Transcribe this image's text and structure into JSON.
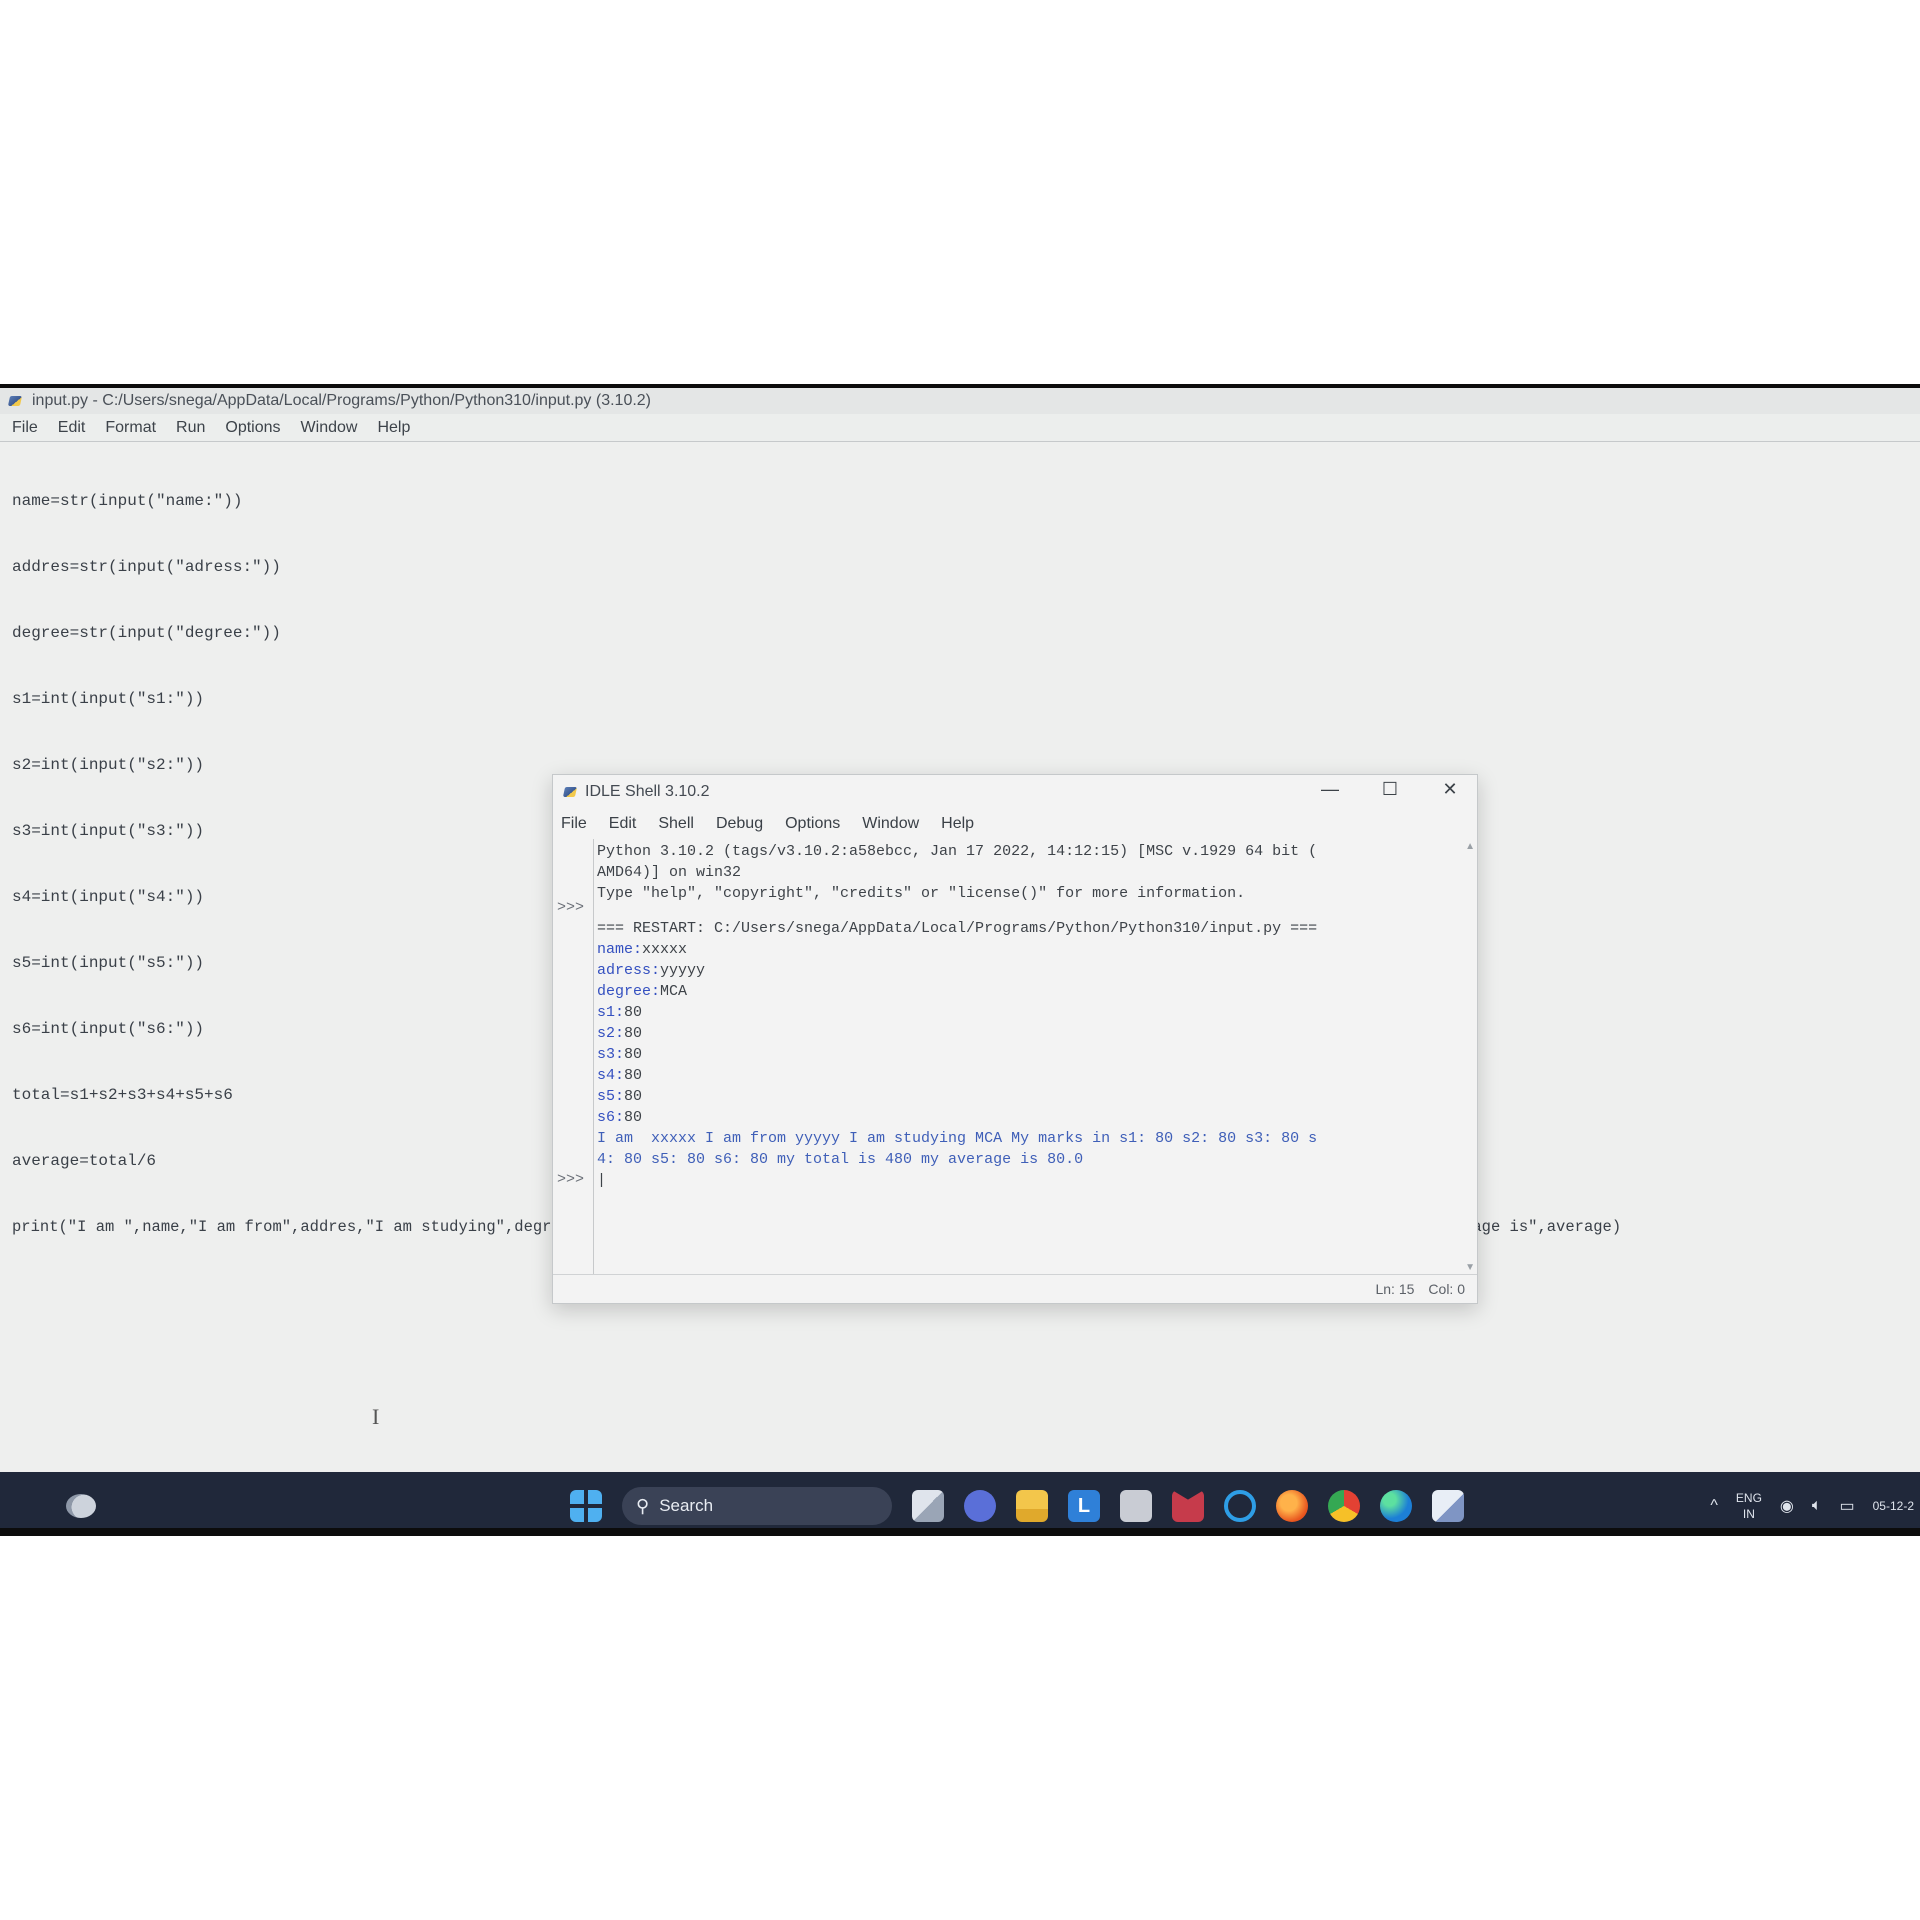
{
  "editor": {
    "title": "input.py - C:/Users/snega/AppData/Local/Programs/Python/Python310/input.py (3.10.2)",
    "menu": [
      "File",
      "Edit",
      "Format",
      "Run",
      "Options",
      "Window",
      "Help"
    ],
    "code_lines": [
      "name=str(input(\"name:\"))",
      "addres=str(input(\"adress:\"))",
      "degree=str(input(\"degree:\"))",
      "s1=int(input(\"s1:\"))",
      "s2=int(input(\"s2:\"))",
      "s3=int(input(\"s3:\"))",
      "s4=int(input(\"s4:\"))",
      "s5=int(input(\"s5:\"))",
      "s6=int(input(\"s6:\"))",
      "total=s1+s2+s3+s4+s5+s6",
      "average=total/6",
      "print(\"I am \",name,\"I am from\",addres,\"I am studying\",degree,\"My marks in\",\"s1:\",s1,\"s2:\",s2,\"s3:\",s3,\"s4:\",s4,\"s5:\",s5,\"s6:\",s6,\"my total is\",total,\"my average is\",average)"
    ]
  },
  "shell": {
    "title": "IDLE Shell 3.10.2",
    "controls": {
      "minimize": "—",
      "maximize": "☐",
      "close": "✕"
    },
    "menu": [
      "File",
      "Edit",
      "Shell",
      "Debug",
      "Options",
      "Window",
      "Help"
    ],
    "prompt": ">>>",
    "banner": [
      "Python 3.10.2 (tags/v3.10.2:a58ebcc, Jan 17 2022, 14:12:15) [MSC v.1929 64 bit (",
      "AMD64)] on win32",
      "Type \"help\", \"copyright\", \"credits\" or \"license()\" for more information."
    ],
    "restart": "=== RESTART: C:/Users/snega/AppData/Local/Programs/Python/Python310/input.py ===",
    "inputs": [
      {
        "prompt": "name:",
        "value": "xxxxx"
      },
      {
        "prompt": "adress:",
        "value": "yyyyy"
      },
      {
        "prompt": "degree:",
        "value": "MCA"
      },
      {
        "prompt": "s1:",
        "value": "80"
      },
      {
        "prompt": "s2:",
        "value": "80"
      },
      {
        "prompt": "s3:",
        "value": "80"
      },
      {
        "prompt": "s4:",
        "value": "80"
      },
      {
        "prompt": "s5:",
        "value": "80"
      },
      {
        "prompt": "s6:",
        "value": "80"
      }
    ],
    "output": [
      "I am  xxxxx I am from yyyyy I am studying MCA My marks in s1: 80 s2: 80 s3: 80 s",
      "4: 80 s5: 80 s6: 80 my total is 480 my average is 80.0"
    ],
    "status": {
      "line": "Ln: 15",
      "col": "Col: 0"
    }
  },
  "taskbar": {
    "search_label": "Search",
    "icons": [
      "start-icon",
      "search-icon",
      "task-view-icon",
      "chat-icon",
      "file-explorer-icon",
      "l-app-icon",
      "store-icon",
      "mcafee-icon",
      "cortana-icon",
      "firefox-icon",
      "chrome-icon",
      "edge-icon",
      "idle-icon"
    ],
    "tray": {
      "chevron": "^",
      "lang_top": "ENG",
      "lang_bottom": "IN",
      "date": "05-12-2"
    }
  }
}
